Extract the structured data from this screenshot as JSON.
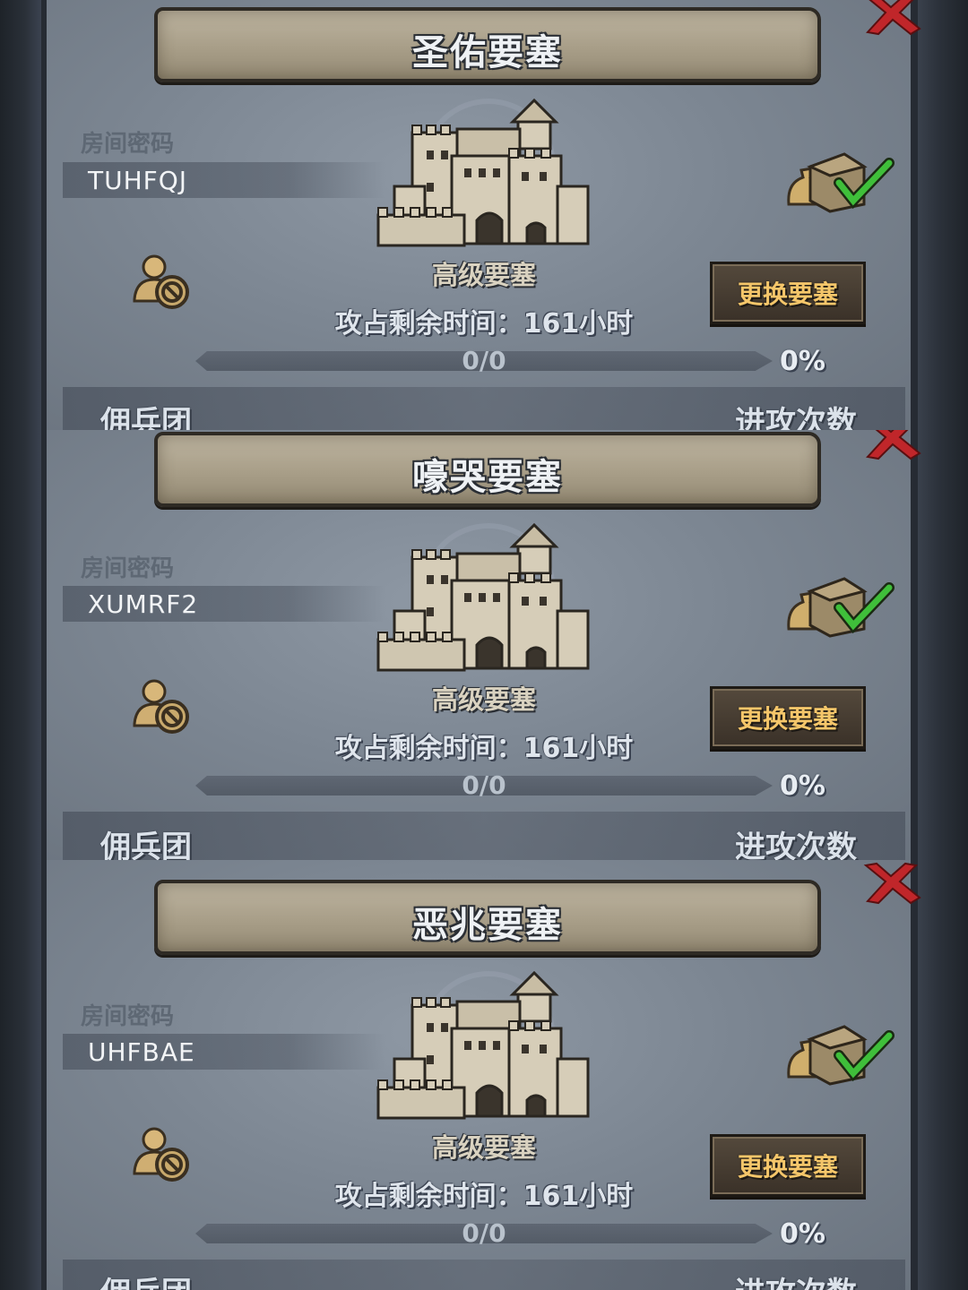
{
  "fortresses": [
    {
      "name": "圣佑要塞",
      "password_label": "房间密码",
      "password": "TUHFQJ",
      "fortress_level": "高级要塞",
      "time_remaining": "攻占剩余时间：161小时",
      "progress_text": "0/0",
      "progress_percent": "0%",
      "progress_fraction": 0,
      "change_button": "更换要塞",
      "mercenary_label": "佣兵团",
      "attack_count_label": "进攻次数"
    },
    {
      "name": "嚎哭要塞",
      "password_label": "房间密码",
      "password": "XUMRF2",
      "fortress_level": "高级要塞",
      "time_remaining": "攻占剩余时间：161小时",
      "progress_text": "0/0",
      "progress_percent": "0%",
      "progress_fraction": 0,
      "change_button": "更换要塞",
      "mercenary_label": "佣兵团",
      "attack_count_label": "进攻次数"
    },
    {
      "name": "恶兆要塞",
      "password_label": "房间密码",
      "password": "UHFBAE",
      "fortress_level": "高级要塞",
      "time_remaining": "攻占剩余时间：161小时",
      "progress_text": "0/0",
      "progress_percent": "0%",
      "progress_fraction": 0,
      "change_button": "更换要塞",
      "mercenary_label": "佣兵团",
      "attack_count_label": "进攻次数"
    }
  ],
  "icons": {
    "close": "close-x-icon",
    "castle": "castle-icon",
    "no_user": "user-banned-icon",
    "loot": "loot-claimed-icon"
  },
  "colors": {
    "button_text": "#f5c66a",
    "close_red": "#c0262a",
    "check_green": "#3fbf3a"
  }
}
